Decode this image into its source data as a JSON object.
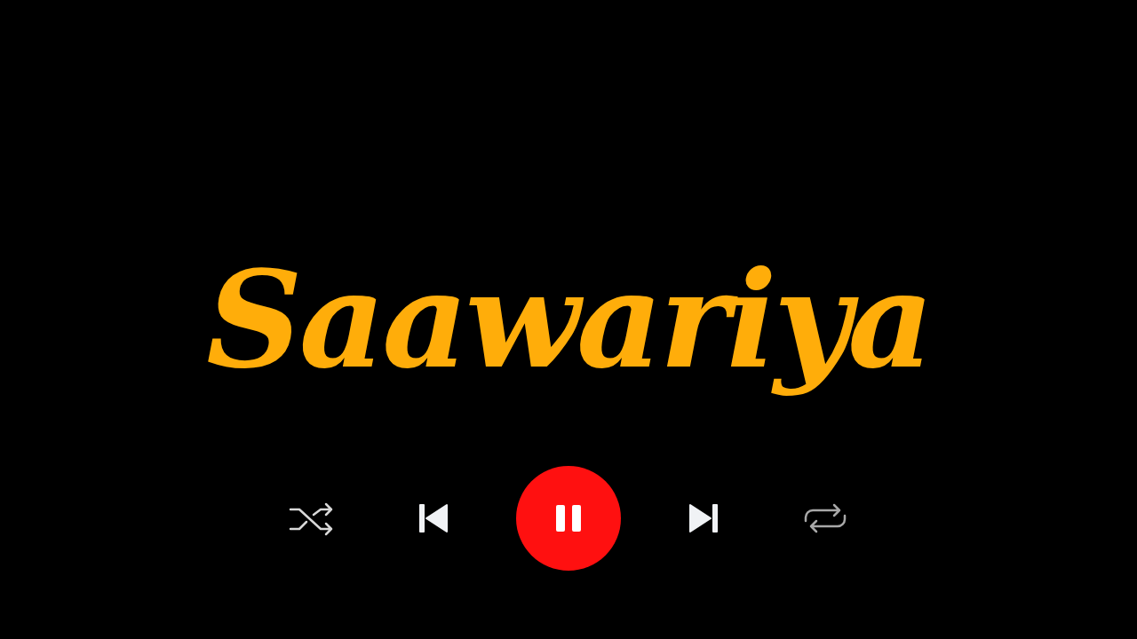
{
  "song": {
    "title": "Saawariya"
  },
  "player": {
    "playing": true
  }
}
